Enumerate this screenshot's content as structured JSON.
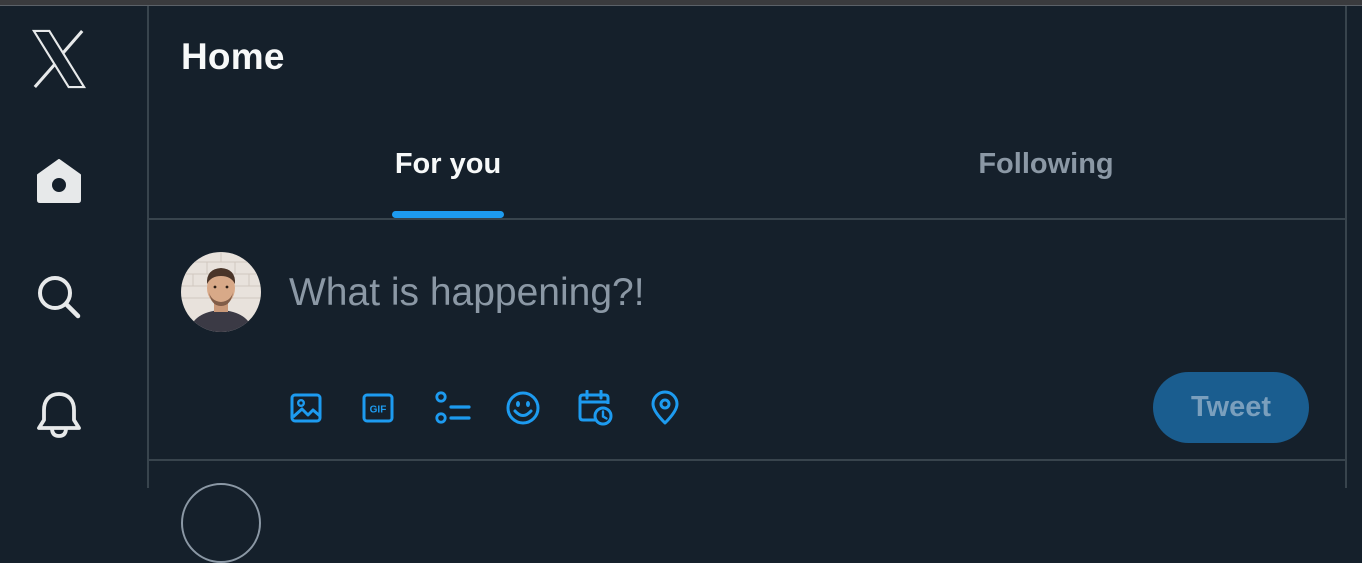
{
  "header": {
    "title": "Home"
  },
  "tabs": [
    {
      "label": "For you",
      "active": true
    },
    {
      "label": "Following",
      "active": false
    }
  ],
  "composer": {
    "placeholder": "What is happening?!",
    "tools": [
      "image-icon",
      "gif-icon",
      "poll-icon",
      "emoji-icon",
      "schedule-icon",
      "location-icon"
    ],
    "gif_label": "GIF",
    "tweet_label": "Tweet"
  },
  "sidebar": {
    "items": [
      "x-logo-icon",
      "home-icon",
      "search-icon",
      "notifications-icon"
    ]
  },
  "colors": {
    "background": "#15202b",
    "accent": "#1d9bf0",
    "text_primary": "#f7f9f9",
    "text_secondary": "#8b98a5",
    "border": "#38444d",
    "tweet_button_disabled": "#1a5d8f"
  }
}
